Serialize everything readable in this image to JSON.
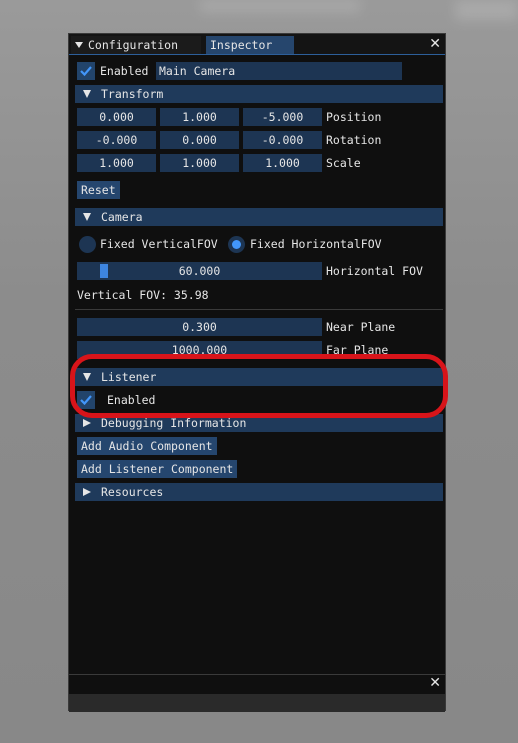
{
  "tabs": [
    {
      "label": "Configuration",
      "active": false
    },
    {
      "label": "Inspector",
      "active": true
    }
  ],
  "close_glyph": "✕",
  "object": {
    "enabled_label": "Enabled",
    "enabled": true,
    "name": "Main Camera"
  },
  "transform": {
    "header": "Transform",
    "rows": [
      {
        "label": "Position",
        "values": [
          "0.000",
          "1.000",
          "-5.000"
        ]
      },
      {
        "label": "Rotation",
        "values": [
          "-0.000",
          "0.000",
          "-0.000"
        ]
      },
      {
        "label": "Scale",
        "values": [
          "1.000",
          "1.000",
          "1.000"
        ]
      }
    ],
    "reset_label": "Reset"
  },
  "camera": {
    "header": "Camera",
    "radio_vertical": "Fixed VerticalFOV",
    "radio_horizontal": "Fixed HorizontalFOV",
    "selected": "horizontal",
    "fov_value": "60.000",
    "fov_label": "Horizontal FOV",
    "vertical_fov_text": "Vertical FOV: 35.98",
    "near_value": "0.300",
    "near_label": "Near Plane",
    "far_value": "1000.000",
    "far_label": "Far Plane"
  },
  "listener": {
    "header": "Listener",
    "enabled_label": "Enabled",
    "enabled": true
  },
  "debugging": {
    "header": "Debugging Information"
  },
  "buttons": {
    "add_audio": "Add Audio Component",
    "add_listener": "Add Listener Component"
  },
  "resources": {
    "header": "Resources"
  },
  "colors": {
    "accent": "#4296fa",
    "header": "#1f3a5b",
    "highlight": "#d8141a"
  }
}
